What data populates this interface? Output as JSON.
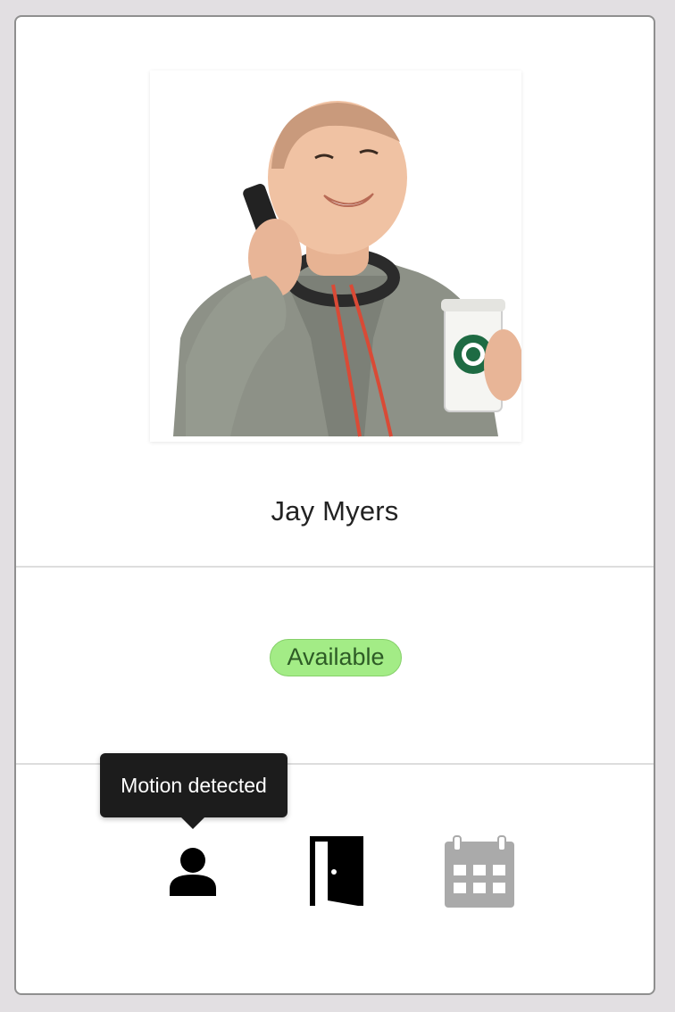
{
  "person": {
    "name": "Jay Myers",
    "photo_alt": "profile-photo"
  },
  "status": {
    "label": "Available",
    "color": "#a3ec86"
  },
  "tooltip": {
    "text": "Motion detected"
  },
  "indicators": [
    {
      "icon": "person-icon",
      "state": "active"
    },
    {
      "icon": "door-open-icon",
      "state": "active"
    },
    {
      "icon": "calendar-icon",
      "state": "inactive"
    }
  ],
  "colors": {
    "background": "#e2dfe2",
    "card": "#ffffff",
    "active_icon": "#000000",
    "inactive_icon": "#aaaaaa",
    "tooltip_bg": "#1c1c1c"
  }
}
